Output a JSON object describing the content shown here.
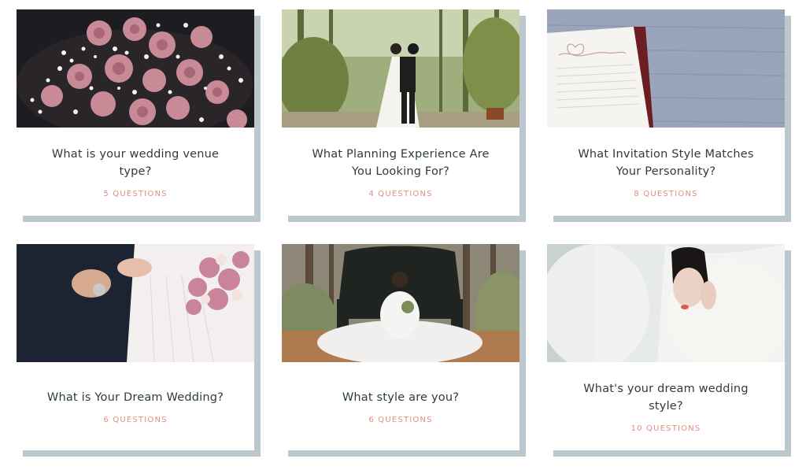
{
  "quizzes": [
    {
      "title": "What is your wedding venue type?",
      "count": "5 QUESTIONS",
      "image": "roses-and-babys-breath-bouquet"
    },
    {
      "title": "What Planning Experience Are You Looking For?",
      "count": "4 QUESTIONS",
      "image": "couple-dancing-in-forest"
    },
    {
      "title": "What Invitation Style Matches Your Personality?",
      "count": "8 QUESTIONS",
      "image": "open-notebook-on-wood"
    },
    {
      "title": "What is Your Dream Wedding?",
      "count": "6 QUESTIONS",
      "image": "bride-groom-holding-hands"
    },
    {
      "title": "What style are you?",
      "count": "6 QUESTIONS",
      "image": "bride-on-throne-in-woods"
    },
    {
      "title": "What's your dream wedding style?",
      "count": "10 QUESTIONS",
      "image": "bride-under-veil"
    }
  ],
  "colors": {
    "title": "#2f3b40",
    "count": "#e08f7f",
    "shadow": "#bcc8cd"
  }
}
